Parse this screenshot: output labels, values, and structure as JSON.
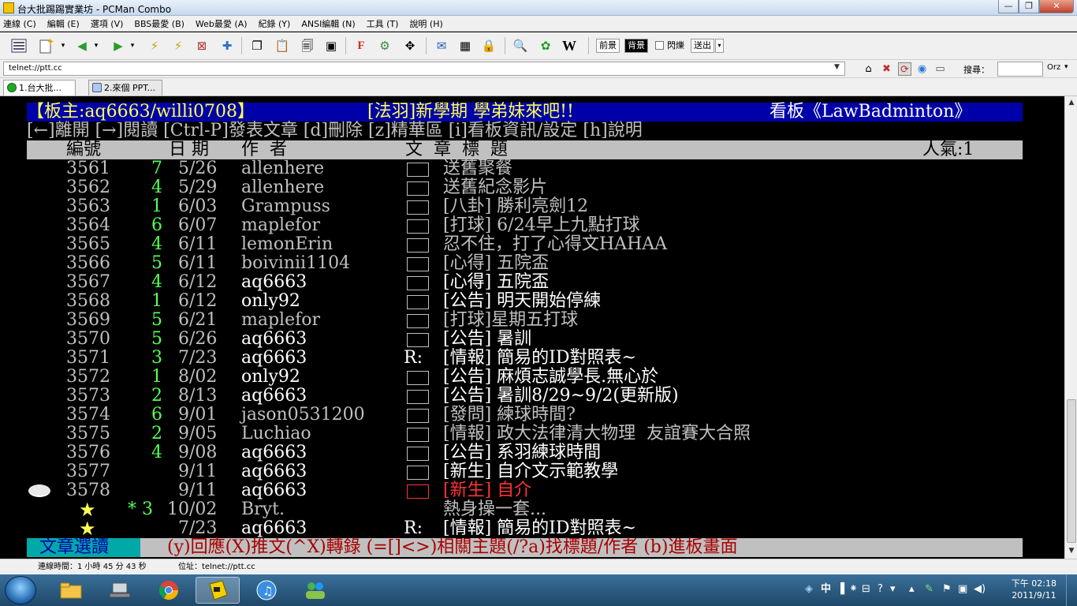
{
  "window": {
    "title": "台大批踢踢實業坊 - PCMan Combo",
    "controls": [
      "—",
      "❐",
      "✕"
    ]
  },
  "menu": [
    "連線 (C)",
    "編輯 (E)",
    "選項 (V)",
    "BBS最愛 (B)",
    "Web最愛 (A)",
    "紀錄 (Y)",
    "ANSI編輯 (N)",
    "工具 (T)",
    "說明 (H)"
  ],
  "toolbar": {
    "fg_label": "前景",
    "bg_label": "背景",
    "blink_label": "閃爍",
    "send_label": "送出"
  },
  "address": {
    "value": "telnet://ptt.cc",
    "search_label": "搜尋：",
    "search_engine": "Orz"
  },
  "tabs": [
    {
      "label": "1.台大批..."
    },
    {
      "label": "2.來個 PPT..."
    }
  ],
  "board": {
    "header_left": "【板主:aq6663/willi0708】",
    "header_mid": "[法羽]新學期 學弟妹來吧!!",
    "header_right": "看板《LawBadminton》",
    "help_line": "[←]離開 [→]閱讀 [Ctrl-P]發表文章 [d]刪除 [z]精華區 [i]看板資訊/設定 [h]說明",
    "col_num": "編號",
    "col_date": "日 期",
    "col_author": "作  者",
    "col_title": "文  章  標  題",
    "popularity": "人氣:1",
    "footer_label": "文章選讀",
    "footer_help": "(y)回應(X)推文(^X)轉錄 (=[]<>)相關主題(/?a)找標題/作者 (b)進板畫面"
  },
  "posts": [
    {
      "num": "3561",
      "recommend": "7",
      "date": "5/26",
      "author": "allenhere",
      "mark": "",
      "title": "送舊聚餐",
      "read": false
    },
    {
      "num": "3562",
      "recommend": "4",
      "date": "5/29",
      "author": "allenhere",
      "mark": "",
      "title": "送舊紀念影片",
      "read": false
    },
    {
      "num": "3563",
      "recommend": "1",
      "date": "6/03",
      "author": "Grampuss",
      "mark": "",
      "title": "[八卦] 勝利亮劍12",
      "read": false
    },
    {
      "num": "3564",
      "recommend": "6",
      "date": "6/07",
      "author": "maplefor",
      "mark": "",
      "title": "[打球] 6/24早上九點打球",
      "read": false
    },
    {
      "num": "3565",
      "recommend": "4",
      "date": "6/11",
      "author": "lemonErin",
      "mark": "",
      "title": "忍不住，打了心得文HAHAA",
      "read": false
    },
    {
      "num": "3566",
      "recommend": "5",
      "date": "6/11",
      "author": "boivinii1104",
      "mark": "",
      "title": "[心得] 五院盃",
      "read": false
    },
    {
      "num": "3567",
      "recommend": "4",
      "date": "6/12",
      "author": "aq6663",
      "mark": "",
      "title": "[心得] 五院盃",
      "read": true
    },
    {
      "num": "3568",
      "recommend": "1",
      "date": "6/12",
      "author": "only92",
      "mark": "",
      "title": "[公告] 明天開始停練",
      "read": true
    },
    {
      "num": "3569",
      "recommend": "5",
      "date": "6/21",
      "author": "maplefor",
      "mark": "",
      "title": "[打球]星期五打球",
      "read": false
    },
    {
      "num": "3570",
      "recommend": "5",
      "date": "6/26",
      "author": "aq6663",
      "mark": "",
      "title": "[公告] 暑訓",
      "read": true
    },
    {
      "num": "3571",
      "recommend": "3",
      "date": "7/23",
      "author": "aq6663",
      "mark": "R:",
      "title": "[情報] 簡易的ID對照表~",
      "read": true
    },
    {
      "num": "3572",
      "recommend": "1",
      "date": "8/02",
      "author": "only92",
      "mark": "",
      "title": "[公告] 麻煩志誠學長.無心於",
      "read": true
    },
    {
      "num": "3573",
      "recommend": "2",
      "date": "8/13",
      "author": "aq6663",
      "mark": "",
      "title": "[公告] 暑訓8/29~9/2(更新版)",
      "read": true
    },
    {
      "num": "3574",
      "recommend": "6",
      "date": "9/01",
      "author": "jason0531200",
      "mark": "",
      "title": "[發問] 練球時間?",
      "read": false
    },
    {
      "num": "3575",
      "recommend": "2",
      "date": "9/05",
      "author": "Luchiao",
      "mark": "",
      "title": "[情報] 政大法律清大物理  友誼賽大合照",
      "read": false
    },
    {
      "num": "3576",
      "recommend": "4",
      "date": "9/08",
      "author": "aq6663",
      "mark": "",
      "title": "[公告] 系羽練球時間",
      "read": true
    },
    {
      "num": "3577",
      "recommend": "",
      "date": "9/11",
      "author": "aq6663",
      "mark": "",
      "title": "[新生] 自介文示範教學",
      "read": true
    },
    {
      "num": "3578",
      "recommend": "",
      "date": "9/11",
      "author": "aq6663",
      "mark": "",
      "title": "[新生] 自介",
      "read": true,
      "selected": true
    },
    {
      "num": "★",
      "recommend": "* 3",
      "date": "10/02",
      "author": "Bryt.",
      "mark": "",
      "title": "熱身操一套...",
      "read": false,
      "pinned": true
    },
    {
      "num": "★",
      "recommend": "",
      "date": "7/23",
      "author": "aq6663",
      "mark": "R:",
      "title": "[情報] 簡易的ID對照表~",
      "read": true,
      "pinned": true
    }
  ],
  "statusbar": {
    "connected_time": "連線時間：1 小時 45 分 43 秒",
    "address": "位址：telnet://ptt.cc"
  },
  "taskbar": {
    "ime": "中",
    "clock_time": "下午 02:18",
    "clock_date": "2011/9/11"
  },
  "colors": {
    "terminal_bg": "#000000",
    "board_header_bg": "#0000a8",
    "board_header_fg": "#ffff55",
    "recommend_green": "#55ff55",
    "selected_red": "#ff3333",
    "footer_cyan": "#00a8a8",
    "footer_text_red": "#a80000"
  }
}
